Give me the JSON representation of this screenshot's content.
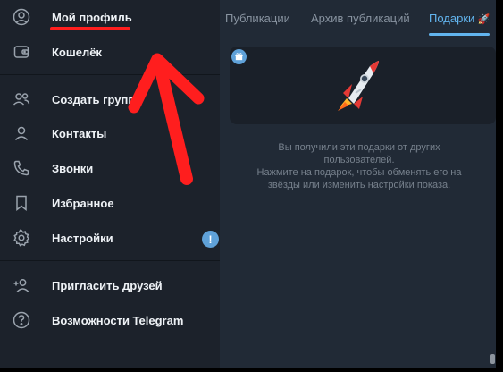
{
  "sidebar": {
    "items": [
      {
        "label": "Мой профиль",
        "icon": "user-circle-icon"
      },
      {
        "label": "Кошелёк",
        "icon": "wallet-icon"
      },
      {
        "label": "Создать группу",
        "icon": "group-icon"
      },
      {
        "label": "Контакты",
        "icon": "contact-icon"
      },
      {
        "label": "Звонки",
        "icon": "phone-icon"
      },
      {
        "label": "Избранное",
        "icon": "bookmark-icon"
      },
      {
        "label": "Настройки",
        "icon": "gear-icon"
      },
      {
        "label": "Пригласить друзей",
        "icon": "add-user-icon"
      },
      {
        "label": "Возможности Telegram",
        "icon": "question-icon"
      }
    ],
    "settings_badge": "!"
  },
  "tabs": [
    {
      "label": "Публикации",
      "active": false
    },
    {
      "label": "Архив публикаций",
      "active": false
    },
    {
      "label": "Подарки",
      "active": true,
      "emoji": "🚀"
    }
  ],
  "gifts": {
    "gift_icon": "rocket-icon",
    "badge_icon": "gift-badge-icon"
  },
  "empty_state": {
    "line1": "Вы получили эти подарки от других",
    "line2": "пользователей.",
    "line3": "Нажмите на подарок, чтобы обменять его на",
    "line4": "звёзды или изменить настройки показа."
  },
  "colors": {
    "accent": "#62b4ee",
    "annotation": "#ff1e1e",
    "sidebar_bg": "#1c222b",
    "main_bg": "#212a36"
  }
}
